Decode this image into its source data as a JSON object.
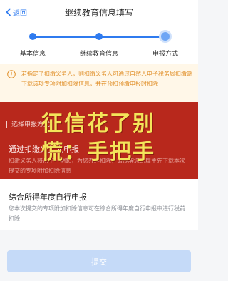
{
  "header": {
    "back_label": "返回",
    "title": "继续教育信息填写"
  },
  "steps": [
    {
      "label": "基本信息"
    },
    {
      "label": "继续教育信息"
    },
    {
      "label": "申报方式"
    }
  ],
  "notice": {
    "text": "若指定了扣缴义务人，则扣缴义务人可通过自然人电子税务局扣缴端下载该项专项附加扣除信息，并在预扣预缴申报时扣除",
    "color": "#e1902a"
  },
  "section": {
    "title": "选择申报方式"
  },
  "options": [
    {
      "title": "通过扣缴义务人申报",
      "desc": "扣缴义务人将从下一期起，为您办理扣除，请提醒您的雇主先下载本次提交的专项附加扣除信息"
    },
    {
      "title": "综合所得年度自行申报",
      "desc": "您本次提交的专项附加扣除信息可在综合所得年度自行申报中进行税前扣除"
    }
  ],
  "watermark": {
    "text": "征信花了别慌：手把手"
  },
  "submit": {
    "label": "提交"
  },
  "colors": {
    "accent": "#2f7bef",
    "overlay": "#b8281c",
    "watermark": "#f4e45a"
  }
}
